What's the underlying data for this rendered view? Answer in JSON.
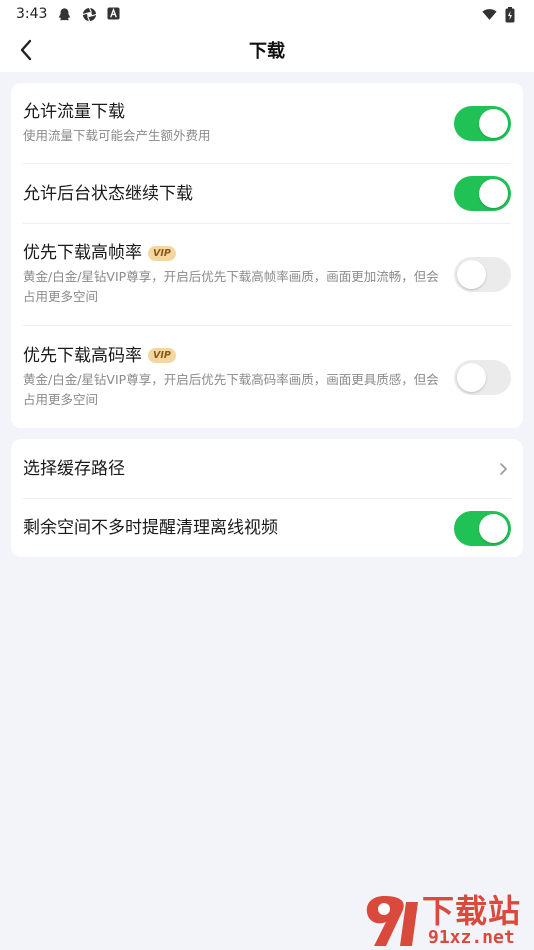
{
  "status_bar": {
    "time": "3:43",
    "icons_left": [
      "qq-icon",
      "aperture-icon",
      "app-a-icon"
    ],
    "icons_right": [
      "wifi-icon",
      "battery-icon"
    ]
  },
  "nav": {
    "title": "下载",
    "back_icon": "chevron-left-icon"
  },
  "settings_group_1": [
    {
      "title": "允许流量下载",
      "subtitle": "使用流量下载可能会产生额外费用",
      "enabled": true
    },
    {
      "title": "允许后台状态继续下载",
      "enabled": true
    },
    {
      "title": "优先下载高帧率",
      "badge": "VIP",
      "subtitle": "黄金/白金/星钻VIP尊享，开启后优先下载高帧率画质，画面更加流畅，但会占用更多空间",
      "enabled": false
    },
    {
      "title": "优先下载高码率",
      "badge": "VIP",
      "subtitle": "黄金/白金/星钻VIP尊享，开启后优先下载高码率画质，画面更具质感，但会占用更多空间",
      "enabled": false
    }
  ],
  "settings_group_2": [
    {
      "title": "选择缓存路径",
      "icon": "chevron-right-icon"
    },
    {
      "title": "剩余空间不多时提醒清理离线视频",
      "enabled": true
    }
  ],
  "watermark": {
    "big_text": "下载站",
    "small_text": "91xz.net"
  },
  "colors": {
    "toggle_on": "#21c255",
    "toggle_off": "#ebebeb",
    "background": "#f2f4f9",
    "vip_badge": "#f3d6a0"
  }
}
